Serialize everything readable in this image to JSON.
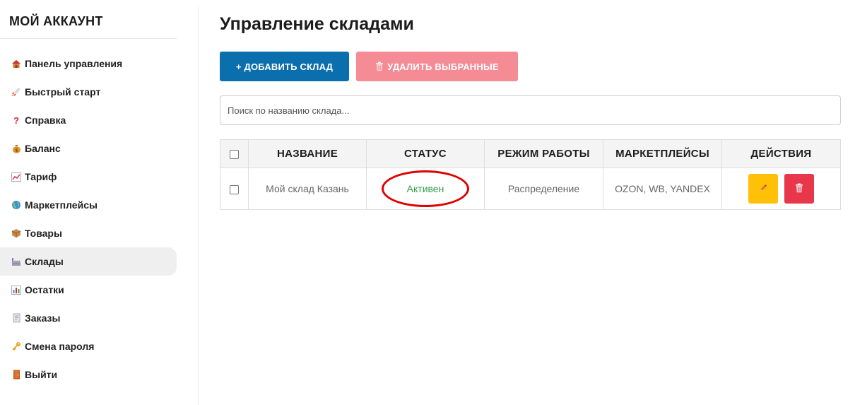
{
  "sidebar": {
    "title": "МОЙ АККАУНТ",
    "items": [
      {
        "label": "Панель управления",
        "icon": "house-icon"
      },
      {
        "label": "Быстрый старт",
        "icon": "rocket-icon"
      },
      {
        "label": "Справка",
        "icon": "question-icon"
      },
      {
        "label": "Баланс",
        "icon": "money-bag-icon"
      },
      {
        "label": "Тариф",
        "icon": "chart-up-icon"
      },
      {
        "label": "Маркетплейсы",
        "icon": "globe-icon"
      },
      {
        "label": "Товары",
        "icon": "package-icon"
      },
      {
        "label": "Склады",
        "icon": "factory-icon",
        "active": true
      },
      {
        "label": "Остатки",
        "icon": "bar-chart-icon"
      },
      {
        "label": "Заказы",
        "icon": "receipt-icon"
      },
      {
        "label": "Смена пароля",
        "icon": "key-icon"
      },
      {
        "label": "Выйти",
        "icon": "door-icon"
      }
    ]
  },
  "main": {
    "title": "Управление складами",
    "add_button": "+ ДОБАВИТЬ СКЛАД",
    "delete_selected_button": "УДАЛИТЬ ВЫБРАННЫЕ",
    "search_placeholder": "Поиск по названию склада..."
  },
  "table": {
    "headers": [
      "НАЗВАНИЕ",
      "СТАТУС",
      "РЕЖИМ РАБОТЫ",
      "МАРКЕТПЛЕЙСЫ",
      "ДЕЙСТВИЯ"
    ],
    "rows": [
      {
        "name": "Мой склад Казань",
        "status": "Активен",
        "mode": "Распределение",
        "marketplaces": "OZON, WB, YANDEX"
      }
    ]
  },
  "colors": {
    "primary": "#0b6fae",
    "danger_light": "#f58b95",
    "danger": "#e8364a",
    "warning": "#ffc107",
    "status_active": "#2e9e4a",
    "highlight_ring": "#e00000"
  }
}
